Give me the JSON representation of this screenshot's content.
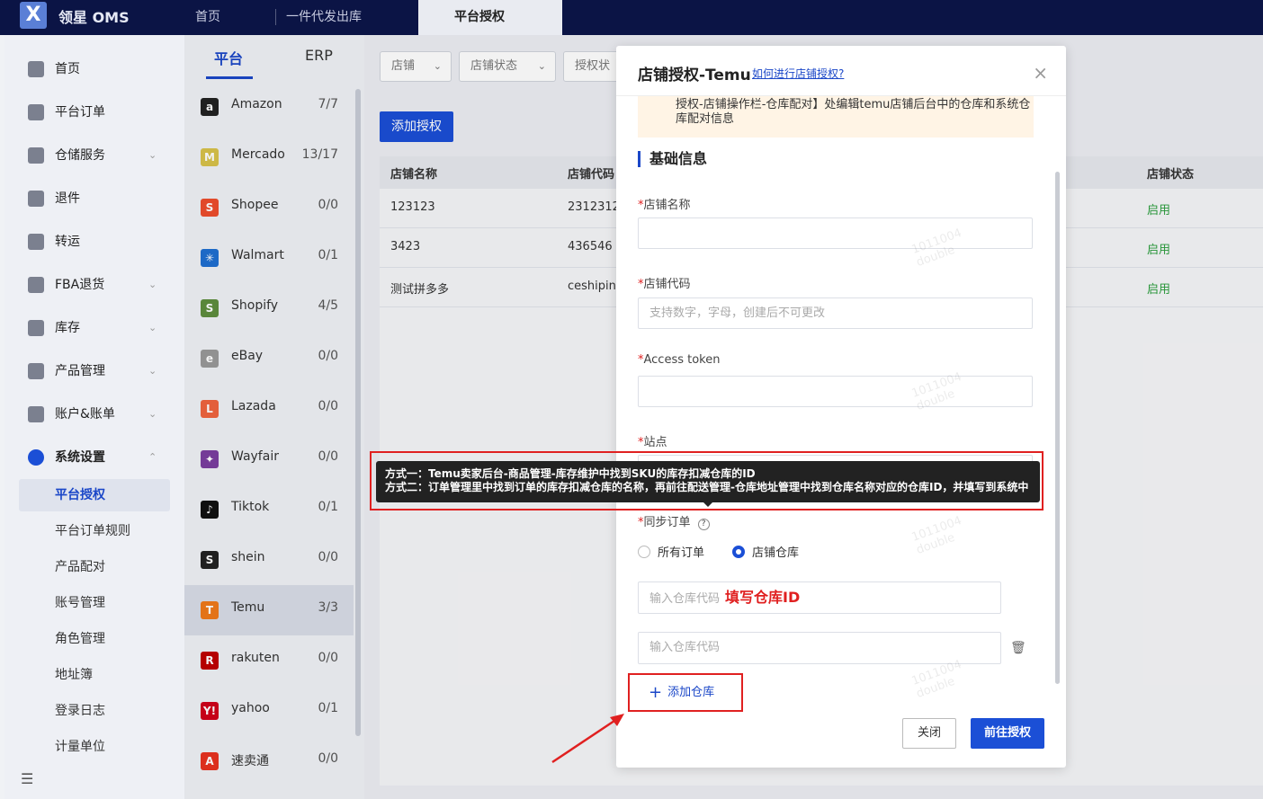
{
  "topbar": {
    "logo_letter": "X",
    "logo_text": "领星 OMS",
    "tabs": [
      {
        "label": "首页"
      },
      {
        "label": "一件代发出库"
      },
      {
        "label": "平台授权"
      }
    ]
  },
  "nav": {
    "items": [
      {
        "label": "首页",
        "icon": "home-icon"
      },
      {
        "label": "平台订单",
        "icon": "order-icon"
      },
      {
        "label": "仓储服务",
        "icon": "warehouse-icon",
        "chevron": "⌄"
      },
      {
        "label": "退件",
        "icon": "return-icon"
      },
      {
        "label": "转运",
        "icon": "transfer-icon"
      },
      {
        "label": "FBA退货",
        "icon": "fba-icon",
        "chevron": "⌄"
      },
      {
        "label": "库存",
        "icon": "inventory-icon",
        "chevron": "⌄"
      },
      {
        "label": "产品管理",
        "icon": "product-icon",
        "chevron": "⌄"
      },
      {
        "label": "账户&账单",
        "icon": "account-icon",
        "chevron": "⌄"
      },
      {
        "label": "系统设置",
        "icon": "settings-icon",
        "chevron": "⌃"
      }
    ],
    "sub_items": [
      {
        "label": "平台授权"
      },
      {
        "label": "平台订单规则"
      },
      {
        "label": "产品配对"
      },
      {
        "label": "账号管理"
      },
      {
        "label": "角色管理"
      },
      {
        "label": "地址簿"
      },
      {
        "label": "登录日志"
      },
      {
        "label": "计量单位"
      }
    ],
    "collapse_glyph": "☰"
  },
  "platform_panel": {
    "tabs": [
      {
        "label": "平台"
      },
      {
        "label": "ERP"
      }
    ],
    "platforms": [
      {
        "name": "Amazon",
        "count": "7/7",
        "glyph": "a",
        "color": "#222222"
      },
      {
        "name": "Mercado",
        "count": "13/17",
        "glyph": "M",
        "color": "#d9c24a"
      },
      {
        "name": "Shopee",
        "count": "0/0",
        "glyph": "S",
        "color": "#ee4d2d"
      },
      {
        "name": "Walmart",
        "count": "0/1",
        "glyph": "✳",
        "color": "#1f6fd1"
      },
      {
        "name": "Shopify",
        "count": "4/5",
        "glyph": "S",
        "color": "#5e8e3e"
      },
      {
        "name": "eBay",
        "count": "0/0",
        "glyph": "e",
        "color": "#999999"
      },
      {
        "name": "Lazada",
        "count": "0/0",
        "glyph": "L",
        "color": "#f0653f"
      },
      {
        "name": "Wayfair",
        "count": "0/0",
        "glyph": "✦",
        "color": "#7b3fa0"
      },
      {
        "name": "Tiktok",
        "count": "0/1",
        "glyph": "♪",
        "color": "#111111"
      },
      {
        "name": "shein",
        "count": "0/0",
        "glyph": "S",
        "color": "#222222"
      },
      {
        "name": "Temu",
        "count": "3/3",
        "glyph": "T",
        "color": "#f07a1a"
      },
      {
        "name": "rakuten",
        "count": "0/0",
        "glyph": "R",
        "color": "#bf0000"
      },
      {
        "name": "yahoo",
        "count": "0/1",
        "glyph": "Y!",
        "color": "#d0021b"
      },
      {
        "name": "速卖通",
        "count": "0/0",
        "glyph": "A",
        "color": "#e8321f"
      }
    ]
  },
  "main": {
    "filters": [
      {
        "label": "店铺",
        "chevron": "⌄"
      },
      {
        "label": "店铺状态",
        "chevron": "⌄"
      },
      {
        "label": "授权状"
      }
    ],
    "add_button": "添加授权",
    "table": {
      "headers": [
        "店铺名称",
        "店铺代码",
        "店铺状态"
      ],
      "rows": [
        {
          "name": "123123",
          "code": "2312312",
          "status": "启用"
        },
        {
          "name": "3423",
          "code": "436546",
          "status": "启用"
        },
        {
          "name": "测试拼多多",
          "code": "ceshipinc",
          "status": "启用"
        }
      ]
    }
  },
  "modal": {
    "title": "店铺授权-Temu",
    "help_link": "如何进行店铺授权?",
    "close_glyph": "×",
    "warning_text": "授权-店铺操作栏-仓库配对】处编辑temu店铺后台中的仓库和系统仓库配对信息",
    "section_title": "基础信息",
    "fields": {
      "shop_name": {
        "label": "店铺名称",
        "value": ""
      },
      "shop_code": {
        "label": "店铺代码",
        "placeholder": "支持数字，字母，创建后不可更改"
      },
      "access_token": {
        "label": "Access token",
        "value": ""
      },
      "site": {
        "label": "站点"
      },
      "sync_orders": {
        "label": "同步订单",
        "help_glyph": "?"
      }
    },
    "required_mark": "*",
    "radio_options": [
      {
        "label": "所有订单",
        "checked": false
      },
      {
        "label": "店铺仓库",
        "checked": true
      }
    ],
    "warehouse_placeholder": "输入仓库代码",
    "fill_hint": "填写仓库ID",
    "trash_glyph": "🗑",
    "add_warehouse": "添加仓库",
    "add_glyph": "+",
    "buttons": {
      "close": "关闭",
      "authorize": "前往授权"
    },
    "watermark_line1": "1011004",
    "watermark_line2": "double"
  },
  "tooltip": {
    "line1": "方式一：Temu卖家后台-商品管理-库存维护中找到SKU的库存扣减仓库的ID",
    "line2": "方式二：订单管理里中找到订单的库存扣减仓库的名称，再前往配送管理-仓库地址管理中找到仓库名称对应的仓库ID，并填写到系统中"
  },
  "colors": {
    "primary": "#1b4fd6",
    "topbar": "#0b1445",
    "annotation_red": "#e02020",
    "status_green": "#2a9d3c"
  }
}
